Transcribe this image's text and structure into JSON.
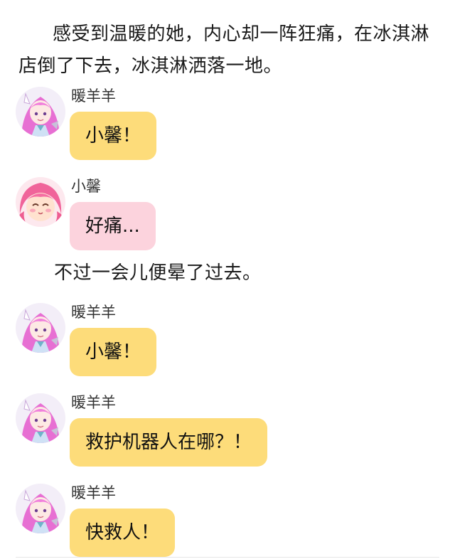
{
  "narrations": [
    "感受到温暖的她，内心却一阵狂痛，在冰淇淋店倒了下去，冰淇淋洒落一地。",
    "不过一会儿便晕了过去。"
  ],
  "messages": [
    {
      "sender": "暖羊羊",
      "text": "小馨！",
      "avatar": "nuanyangyang-avatar",
      "bubble_color": "#fddc7a"
    },
    {
      "sender": "小馨",
      "text": "好痛...",
      "avatar": "xiaoxin-avatar",
      "bubble_color": "#fcd3dd"
    },
    {
      "sender": "暖羊羊",
      "text": "小馨！",
      "avatar": "nuanyangyang-avatar",
      "bubble_color": "#fddc7a"
    },
    {
      "sender": "暖羊羊",
      "text": "救护机器人在哪？！",
      "avatar": "nuanyangyang-avatar",
      "bubble_color": "#fddc7a"
    },
    {
      "sender": "暖羊羊",
      "text": "快救人！",
      "avatar": "nuanyangyang-avatar",
      "bubble_color": "#fddc7a"
    }
  ]
}
